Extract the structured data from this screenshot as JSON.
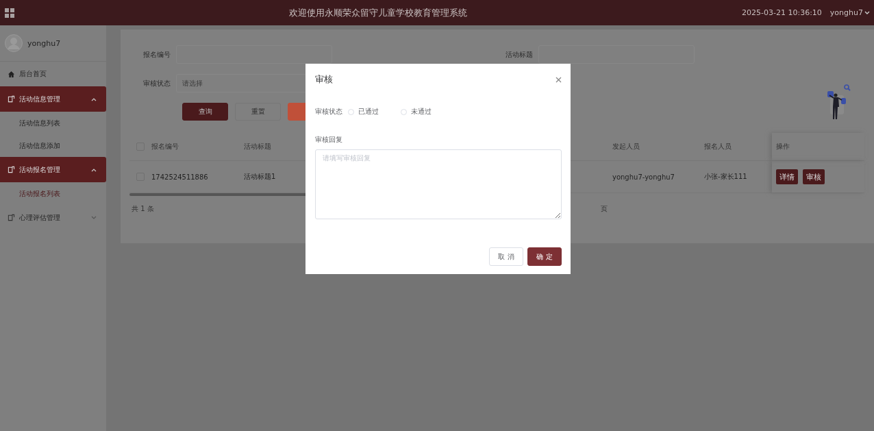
{
  "header": {
    "title": "欢迎使用永顺荣众留守儿童学校教育管理系统",
    "datetime": "2025-03-21 10:36:10",
    "user": "yonghu7"
  },
  "sidebar": {
    "user": "yonghu7",
    "items": [
      {
        "kind": "link",
        "label": "后台首页"
      },
      {
        "kind": "group",
        "label": "活动信息管理",
        "expanded": true,
        "children": [
          {
            "label": "活动信息列表",
            "selected": false
          },
          {
            "label": "活动信息添加",
            "selected": false
          }
        ]
      },
      {
        "kind": "group",
        "label": "活动报名管理",
        "expanded": true,
        "children": [
          {
            "label": "活动报名列表",
            "selected": true
          }
        ]
      },
      {
        "kind": "group",
        "label": "心理评估管理",
        "expanded": false
      }
    ]
  },
  "search": {
    "fields": [
      {
        "label": "报名编号"
      },
      {
        "label": "活动标题"
      },
      {
        "label": "审核状态",
        "placeholder": "请选择"
      }
    ],
    "buttons": [
      {
        "kind": "primary",
        "label": "查询"
      },
      {
        "kind": "plain",
        "label": "重置"
      },
      {
        "kind": "danger"
      }
    ]
  },
  "table": {
    "all_checked": false,
    "columns": [
      "报名编号",
      "活动标题",
      "发起人员",
      "报名人员",
      "操作"
    ],
    "rows": [
      {
        "checked": false,
        "cells": [
          "1742524511886",
          "活动标题1",
          "yonghu7-yonghu7",
          "小张-家长111"
        ],
        "actions": [
          "详情",
          "审核"
        ]
      }
    ]
  },
  "pagination": {
    "total": "共 1 条",
    "page_suffix": "页"
  },
  "dialog": {
    "title": "审核",
    "status_label": "审核状态",
    "options": [
      {
        "label": "已通过",
        "selected": false
      },
      {
        "label": "未通过",
        "selected": false
      }
    ],
    "reply_label": "审核回复",
    "reply_placeholder": "请填写审核回复",
    "buttons": [
      {
        "kind": "plain",
        "label": "取 消"
      },
      {
        "kind": "primary",
        "label": "确 定"
      }
    ]
  }
}
